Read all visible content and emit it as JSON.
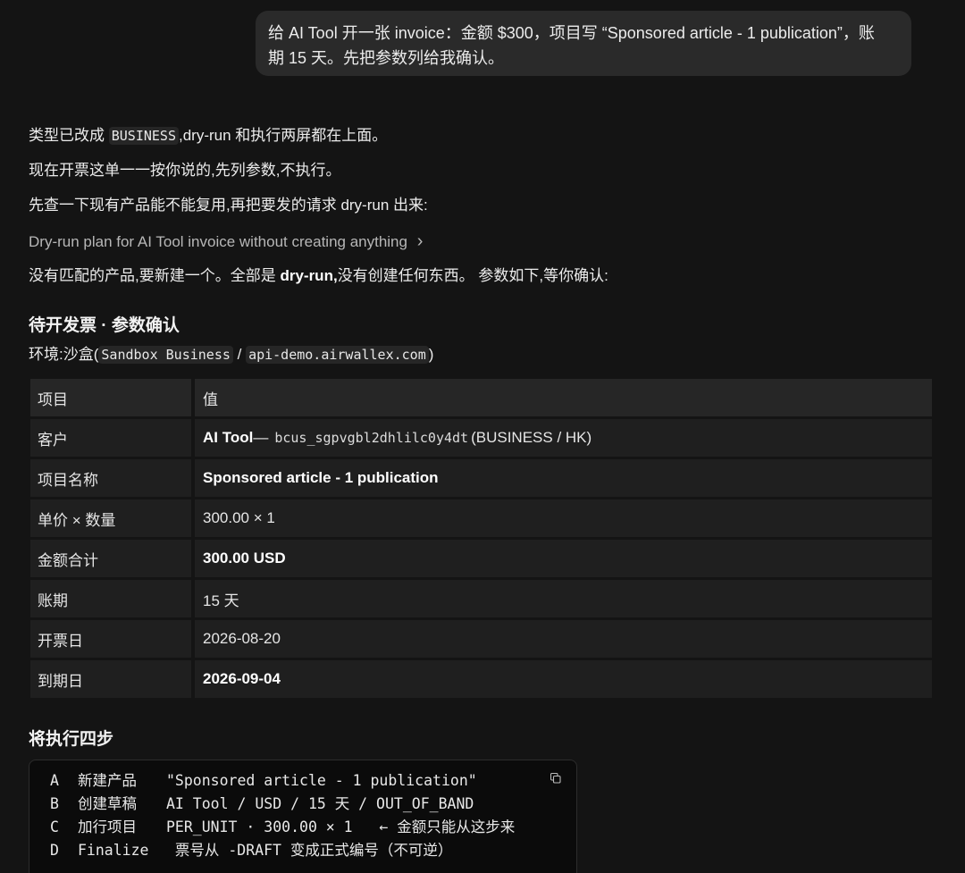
{
  "user_message": {
    "line1": "给 AI Tool 开一张 invoice：金额 $300，项目写 “Sponsored article - 1 publication”，账",
    "line2": "期 15 天。先把参数列给我确认。"
  },
  "assistant": {
    "line1_prefix": "类型已改成 ",
    "line1_code": "BUSINESS",
    "line1_suffix": ",dry-run 和执行两屏都在上面。",
    "line2": "现在开票这单一一按你说的,先列参数,不执行。",
    "line3": "先查一下现有产品能不能复用,再把要发的请求 dry-run 出来:",
    "dryrun_link": "Dry-run plan for AI Tool invoice without creating anything",
    "dryrun_chevron": "›",
    "line5_prefix": "没有匹配的产品,要新建一个。全部是 ",
    "line5_bold": "dry-run,",
    "line5_suffix": "没有创建任何东西。 参数如下,等你确认:"
  },
  "params_section": {
    "title": "待开发票 · 参数确认",
    "env_prefix": "环境:沙盒(",
    "env_code1": "Sandbox Business",
    "env_sep": " / ",
    "env_code2": "api-demo.airwallex.com",
    "env_suffix": ")"
  },
  "params_table": {
    "header": {
      "key": "项目",
      "value": "值"
    },
    "rows": [
      {
        "key": "客户",
        "value_bold": "AI Tool",
        "value_dash": " — ",
        "value_code": "bcus_sgpvgbl2dhlilc0y4dt",
        "value_rest": "(BUSINESS / HK)"
      },
      {
        "key": "项目名称",
        "value_bold": "Sponsored article - 1 publication"
      },
      {
        "key": "单价 × 数量",
        "value": "300.00 × 1"
      },
      {
        "key": "金额合计",
        "value_bold": "300.00 USD"
      },
      {
        "key": "账期",
        "value": "15 天"
      },
      {
        "key": "开票日",
        "value": "2026-08-20"
      },
      {
        "key": "到期日",
        "value_bold": "2026-09-04"
      }
    ]
  },
  "steps_section": {
    "title": "将执行四步",
    "lines": [
      {
        "letter": "A",
        "label": "新建产品",
        "text": "\"Sponsored article - 1 publication\""
      },
      {
        "letter": "B",
        "label": "创建草稿",
        "text": "AI Tool / USD / 15 天 / OUT_OF_BAND"
      },
      {
        "letter": "C",
        "label": "加行项目",
        "text": "PER_UNIT · 300.00 × 1   ← 金额只能从这步来"
      },
      {
        "letter": "D",
        "label": "Finalize",
        "text": " 票号从 -DRAFT 变成正式编号（不可逆）"
      }
    ]
  },
  "icons": {
    "copy": "copy-icon",
    "chevron": "chevron-right-icon"
  }
}
